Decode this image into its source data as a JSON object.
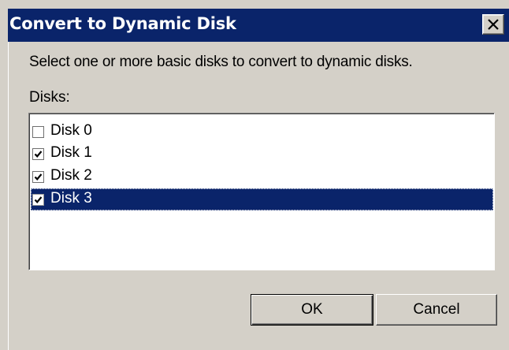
{
  "window": {
    "title": "Convert to Dynamic Disk",
    "close_icon": "close-icon"
  },
  "instruction": "Select one or more basic disks to convert to dynamic disks.",
  "disks_label": "Disks:",
  "disks": [
    {
      "label": "Disk 0",
      "checked": false,
      "selected": false
    },
    {
      "label": "Disk 1",
      "checked": true,
      "selected": false
    },
    {
      "label": "Disk 2",
      "checked": true,
      "selected": false
    },
    {
      "label": "Disk 3",
      "checked": true,
      "selected": true
    }
  ],
  "buttons": {
    "ok": "OK",
    "cancel": "Cancel"
  },
  "colors": {
    "title_bar": "#0a246a",
    "dialog_face": "#d4d0c8",
    "selection": "#0a246a"
  }
}
